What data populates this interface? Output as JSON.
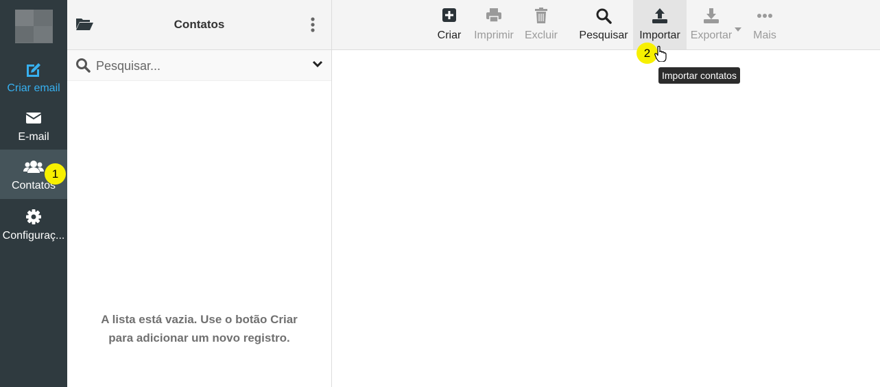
{
  "nav": {
    "items": [
      {
        "label": "Criar email",
        "icon": "compose-icon"
      },
      {
        "label": "E-mail",
        "icon": "envelope-icon"
      },
      {
        "label": "Contatos",
        "icon": "users-icon"
      },
      {
        "label": "Configuraç...",
        "icon": "gear-icon"
      }
    ],
    "active": "Contatos"
  },
  "panel": {
    "title": "Contatos",
    "search_placeholder": "Pesquisar...",
    "empty_line1": "A lista está vazia. Use o botão Criar",
    "empty_line2": "para adicionar um novo registro."
  },
  "toolbar": {
    "buttons": [
      {
        "label": "Criar",
        "icon": "plus-square-icon",
        "enabled": true
      },
      {
        "label": "Imprimir",
        "icon": "printer-icon",
        "enabled": false
      },
      {
        "label": "Excluir",
        "icon": "trash-icon",
        "enabled": false
      },
      {
        "label": "Pesquisar",
        "icon": "search-icon",
        "enabled": true
      },
      {
        "label": "Importar",
        "icon": "upload-icon",
        "enabled": true
      },
      {
        "label": "Exportar",
        "icon": "download-icon",
        "enabled": false
      },
      {
        "label": "Mais",
        "icon": "more-icon",
        "enabled": false
      }
    ]
  },
  "tooltip": "Importar contatos",
  "annotations": {
    "step1": "1",
    "step2": "2"
  },
  "colors": {
    "nav_bg": "#2f3a3f",
    "nav_active": "#45545a",
    "accent": "#37b0f0",
    "badge": "#f7f000"
  }
}
